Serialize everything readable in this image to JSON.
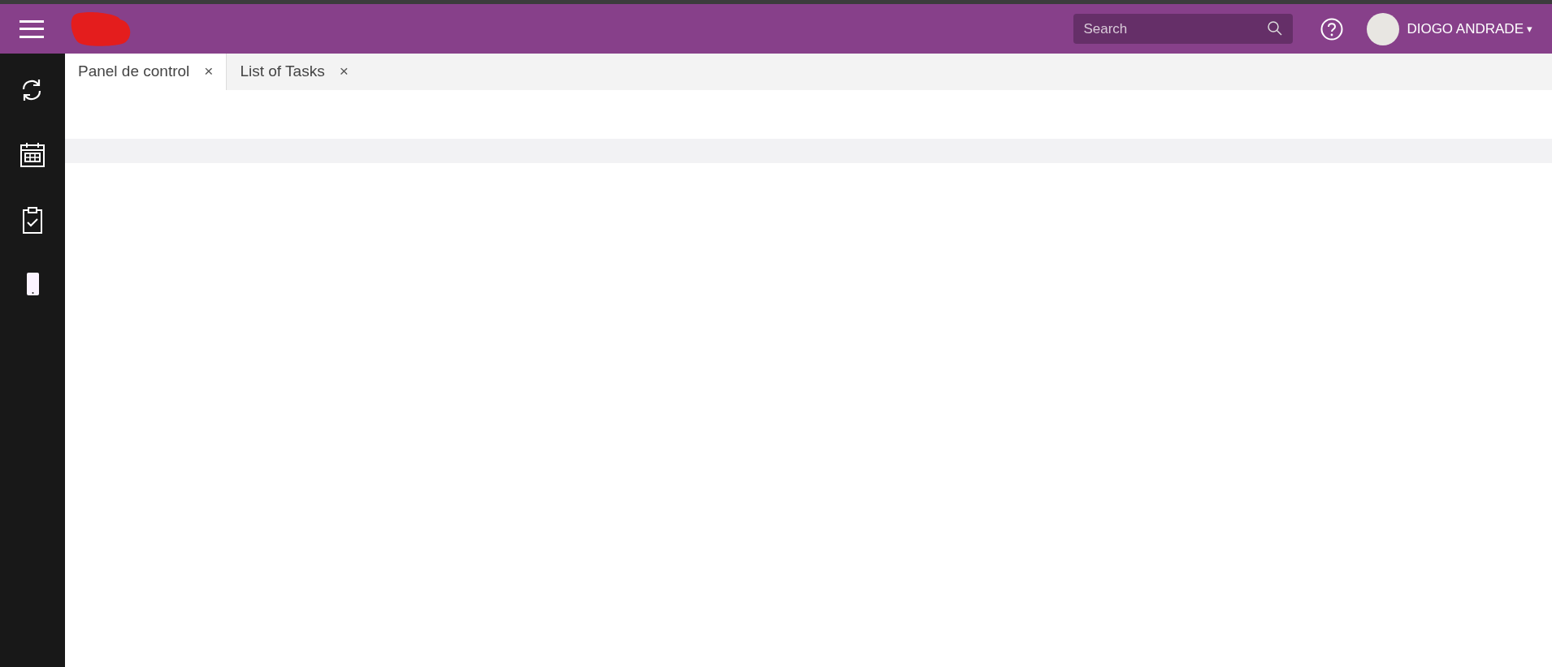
{
  "header": {
    "search": {
      "placeholder": "Search"
    },
    "user": {
      "name": "DIOGO ANDRADE",
      "caret": "▾"
    }
  },
  "sidebar": {
    "items": [
      {
        "kind": "sync"
      },
      {
        "kind": "calendar"
      },
      {
        "kind": "clipboard"
      },
      {
        "kind": "phone"
      }
    ]
  },
  "tabs": [
    {
      "label": "Panel de control",
      "close": "×",
      "selected": true
    },
    {
      "label": "List of Tasks",
      "close": "×",
      "selected": false
    }
  ]
}
